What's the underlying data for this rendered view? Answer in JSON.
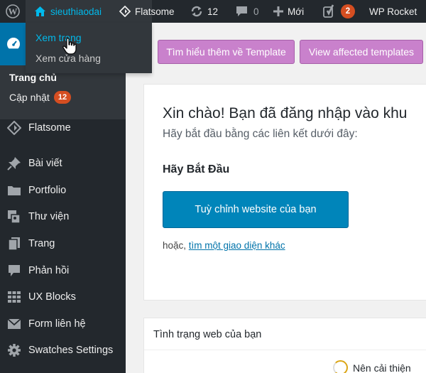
{
  "adminbar": {
    "site_name": "sieuthiaodai",
    "flatsome": "Flatsome",
    "updates_count": "12",
    "comments_count": "0",
    "new_label": "Mới",
    "yoast_badge": "2",
    "wp_rocket": "WP Rocket"
  },
  "site_dropdown": {
    "view_site": "Xem trang",
    "view_store": "Xem cửa hàng"
  },
  "sidebar": {
    "submenu": {
      "home": "Trang chủ",
      "updates": "Cập nhật",
      "updates_badge": "12"
    },
    "items": [
      {
        "label": "Flatsome",
        "icon": "flatsome-icon"
      },
      {
        "label": "Bài viết",
        "icon": "pin-icon"
      },
      {
        "label": "Portfolio",
        "icon": "folder-icon"
      },
      {
        "label": "Thư viện",
        "icon": "media-icon"
      },
      {
        "label": "Trang",
        "icon": "pages-icon"
      },
      {
        "label": "Phản hồi",
        "icon": "comment-icon"
      },
      {
        "label": "UX Blocks",
        "icon": "grid-icon"
      },
      {
        "label": "Form liên hệ",
        "icon": "mail-icon"
      },
      {
        "label": "Swatches Settings",
        "icon": "gear-icon"
      }
    ]
  },
  "template_buttons": {
    "learn": "Tìm hiểu thêm về Template",
    "view": "View affected templates"
  },
  "welcome": {
    "title": "Xin chào! Bạn đã đăng nhập vào khu",
    "subtitle": "Hãy bắt đầu bằng các liên kết dưới đây:",
    "start_heading": "Hãy Bắt Đầu",
    "customize_button": "Tuỳ chỉnh website của bạn",
    "or_text": "hoặc, ",
    "other_theme_link": "tìm một giao diện khác"
  },
  "site_health": {
    "title": "Tình trạng web của bạn",
    "status": "Nên cải thiện"
  },
  "colors": {
    "adminbar_bg": "#23282d",
    "accent_blue": "#0073aa",
    "template_button": "#c981cc",
    "badge": "#d54e21",
    "health_ring": "#dba617"
  }
}
